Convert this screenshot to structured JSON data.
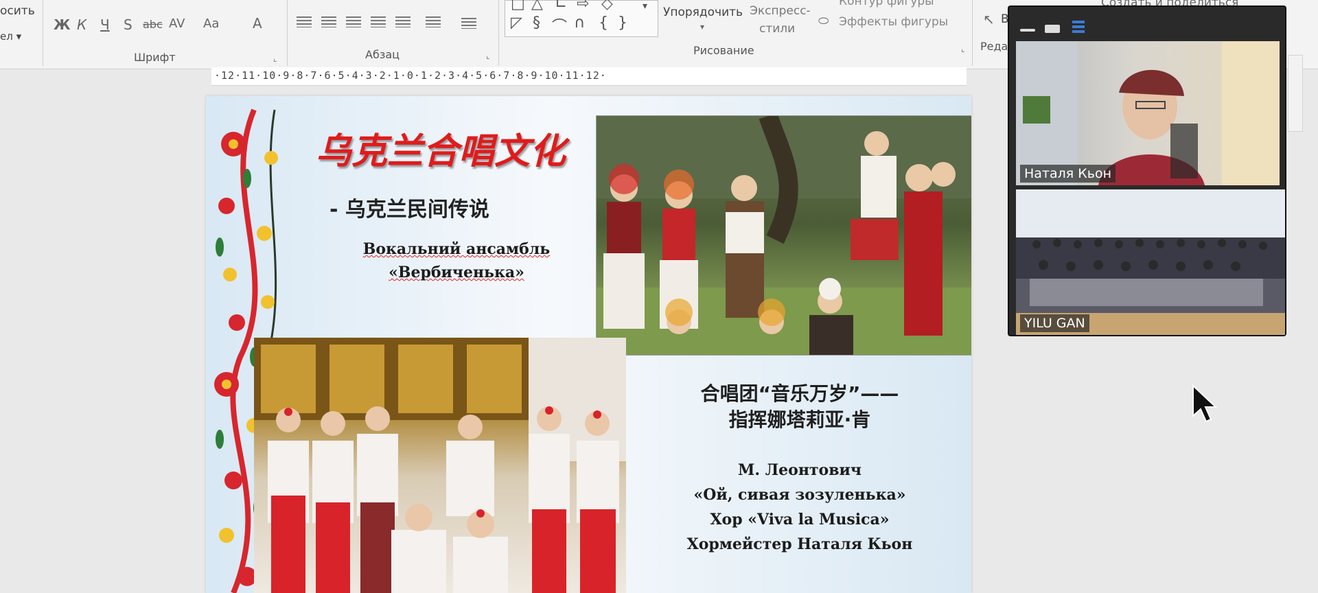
{
  "ribbon": {
    "left_cut_1": "осить",
    "left_cut_2": "ел ▾",
    "font_group": "Шрифт",
    "paragraph_group": "Абзац",
    "drawing_group": "Рисование",
    "editing_group": "Реда",
    "font_buttons": [
      "Ж",
      "К",
      "Ч",
      "S",
      "abc",
      "AV",
      "Aa",
      "A"
    ],
    "arrange_label": "Упорядочить",
    "quick_styles_1": "Экспресс-",
    "quick_styles_2": "стили",
    "shape_outline": "Контур фигуры",
    "shape_effects": "Эффекты фигуры",
    "share_label": "Создать и поделиться",
    "select_cut": "В"
  },
  "ruler": {
    "text": "·12·11·10·9·8·7·6·5·4·3·2·1·0·1·2·3·4·5·6·7·8·9·10·11·12·"
  },
  "slide": {
    "title": "乌克兰合唱文化",
    "subtitle": "- 乌克兰民间传说",
    "ensemble_line1": "Вокальний ансамбль",
    "ensemble_line2": "«Вербиченька»",
    "choir_line1": "合唱团“音乐万岁”——",
    "choir_line2": "指挥娜塔莉亚·肯",
    "program_line1": "М. Леонтович",
    "program_line2": "«Ой, сивая зозуленька»",
    "program_line3": "Хор «Viva la Musica»",
    "program_line4": "Хормейстер Наталя Кьон"
  },
  "video": {
    "participant1": "Наталя Кьон",
    "participant2": "YILU GAN"
  },
  "colors": {
    "title_red": "#e01b1b",
    "slide_blue": "#d8e8f4",
    "panel_dark": "#2a2a2a",
    "view_blue": "#3b7bd6"
  }
}
